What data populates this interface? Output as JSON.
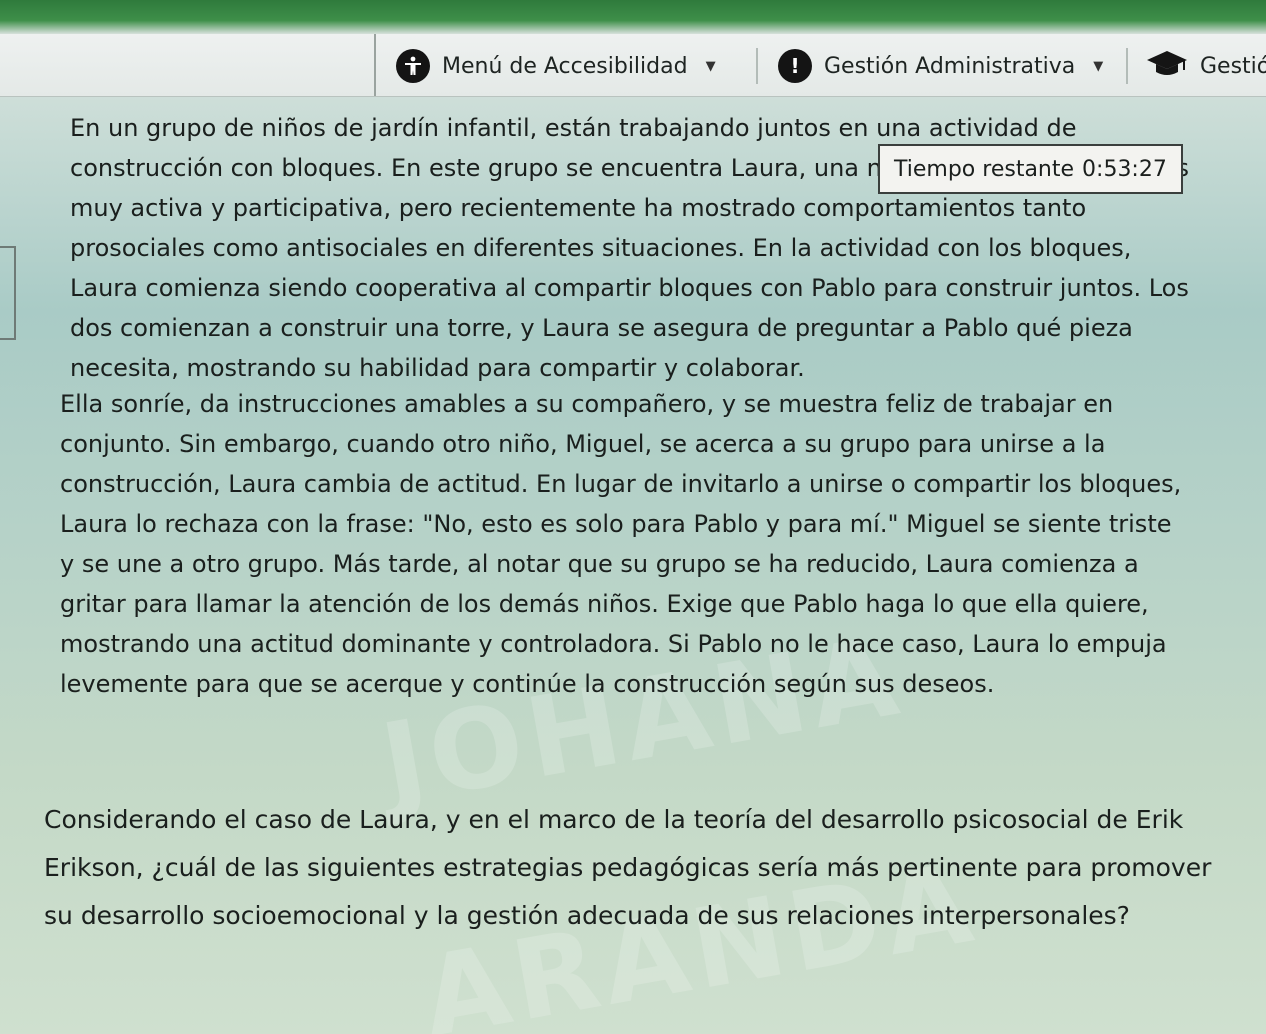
{
  "nav": {
    "accessibility": {
      "label": "Menú de Accesibilidad",
      "icon": "accessibility-icon"
    },
    "admin": {
      "label": "Gestión Administrativa",
      "icon": "alert-icon"
    },
    "academic": {
      "label": "Gestió",
      "icon": "graduation-cap-icon"
    }
  },
  "timer": {
    "label": "Tiempo restante",
    "value": "0:53:27"
  },
  "case_text": {
    "paragraph1": "En un grupo de niños de jardín infantil, están trabajando juntos en una actividad de construcción con bloques. En este grupo se encuentra Laura, una niña que, por lo general es muy activa y participativa, pero recientemente ha mostrado comportamientos tanto prosociales como antisociales en diferentes situaciones. En la actividad con los bloques, Laura comienza siendo cooperativa al compartir bloques con Pablo para construir juntos. Los dos comienzan a construir una torre, y Laura se asegura de preguntar a Pablo qué pieza necesita, mostrando su habilidad para compartir y colaborar.",
    "paragraph2": "Ella sonríe, da instrucciones amables a su compañero, y se muestra feliz de trabajar en conjunto. Sin embargo, cuando otro niño, Miguel, se acerca a su grupo para unirse a la construcción, Laura cambia de actitud. En lugar de invitarlo a unirse o compartir los bloques, Laura lo rechaza con la frase: \"No, esto es solo para Pablo y para mí.\" Miguel se siente triste y se une a otro grupo. Más tarde, al notar que su grupo se ha reducido, Laura comienza a gritar para llamar la atención de los demás niños. Exige que Pablo haga lo que ella quiere, mostrando una actitud dominante y controladora. Si Pablo no le hace caso, Laura lo empuja levemente para que se acerque y continúe la construcción según sus deseos.",
    "question": "Considerando el caso de Laura, y en el marco de la teoría del desarrollo psicosocial de Erik Erikson, ¿cuál de las siguientes estrategias pedagógicas sería más pertinente para promover su desarrollo socioemocional y la gestión adecuada de sus relaciones interpersonales?"
  },
  "watermark": [
    "JOHANA",
    "ARANDA"
  ],
  "colors": {
    "top_stripe": "#3e8f49",
    "navbar_bg": "#e8ecea",
    "text": "#1a1f1d",
    "timer_bg": "#f3f3f0"
  }
}
